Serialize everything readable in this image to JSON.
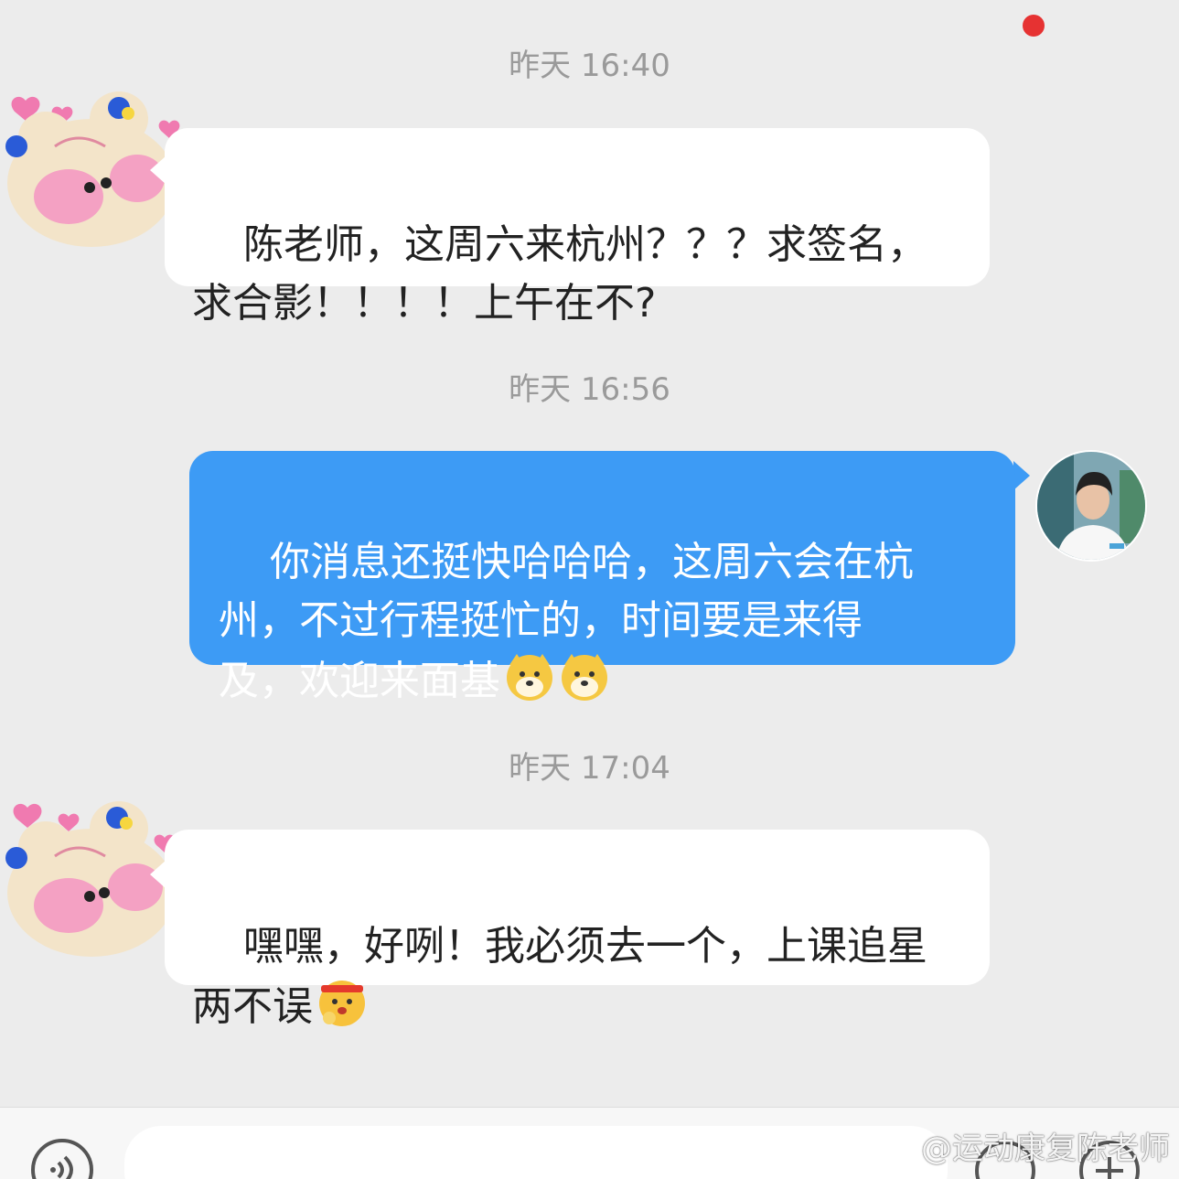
{
  "conversation": {
    "messages": [
      {
        "timestamp": "昨天 16:40",
        "sender": "fan",
        "text": "陈老师，这周六来杭州？？？求签名，\n求合影！！！！上午在不?"
      },
      {
        "timestamp": "昨天 16:56",
        "sender": "teacher",
        "text": "你消息还挺快哈哈哈，这周六会在杭\n州，不过行程挺忙的，时间要是来得\n及，欢迎来面基",
        "emojis": [
          "doge-emoji",
          "doge-emoji"
        ]
      },
      {
        "timestamp": "昨天 17:04",
        "sender": "fan",
        "text": "嘿嘿，好咧！我必须去一个，上课追星\n两不误",
        "emojis": [
          "fighting-emoji"
        ]
      }
    ]
  },
  "colors": {
    "background": "#ececec",
    "incoming_bubble": "#ffffff",
    "outgoing_bubble": "#3d9bf5",
    "timestamp_text": "#9a9a9a",
    "notification_dot": "#e63232"
  },
  "input_bar": {
    "icons": [
      "voice-icon",
      "emoji-icon",
      "plus-icon"
    ],
    "has_notification_dot": true
  },
  "watermark": {
    "text": "@运动康复陈老师",
    "icon": "weibo-logo-icon"
  }
}
